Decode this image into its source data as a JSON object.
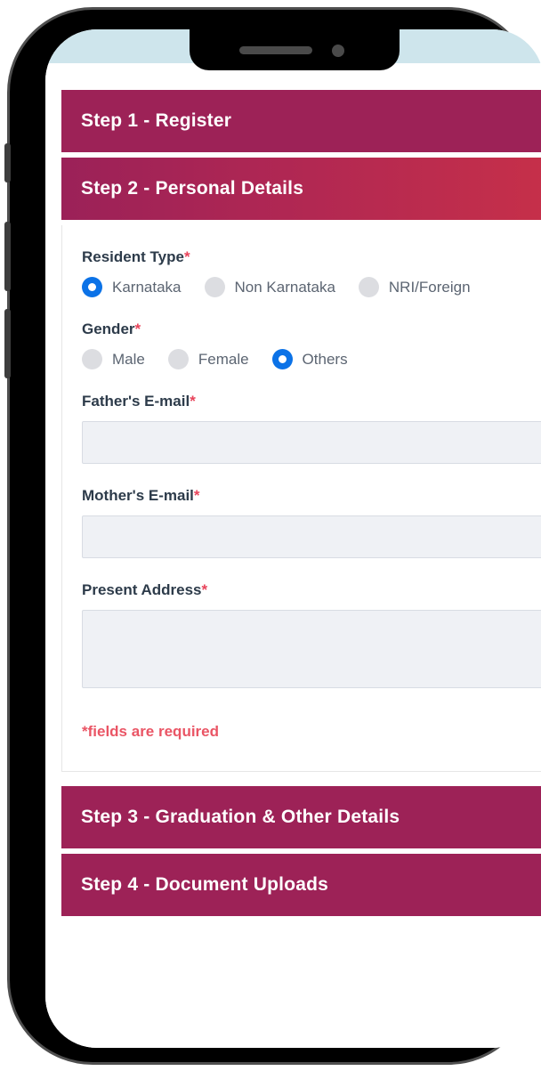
{
  "device": {
    "notch": {
      "speaker_icon": "speaker-grill-icon",
      "camera_icon": "front-camera-icon"
    },
    "buttons": {
      "mute": "mute-switch",
      "volume_up": "volume-up-button",
      "volume_down": "volume-down-button",
      "power": "power-button"
    }
  },
  "form": {
    "steps": [
      {
        "label": "Step 1 - Register",
        "state": "collapsed"
      },
      {
        "label": "Step 2 - Personal Details",
        "state": "expanded"
      },
      {
        "label": "Step 3 - Graduation & Other Details",
        "state": "collapsed"
      },
      {
        "label": "Step 4 - Document Uploads",
        "state": "collapsed"
      }
    ],
    "fields": {
      "resident_type": {
        "label": "Resident Type",
        "required_marker": "*",
        "options": [
          {
            "label": "Karnataka",
            "selected": true
          },
          {
            "label": "Non Karnataka",
            "selected": false
          },
          {
            "label": "NRI/Foreign",
            "selected": false
          }
        ]
      },
      "gender": {
        "label": "Gender",
        "required_marker": "*",
        "options": [
          {
            "label": "Male",
            "selected": false
          },
          {
            "label": "Female",
            "selected": false
          },
          {
            "label": "Others",
            "selected": true
          }
        ]
      },
      "father_email": {
        "label": "Father's E-mail",
        "required_marker": "*",
        "value": "",
        "placeholder": ""
      },
      "mother_email": {
        "label": "Mother's E-mail",
        "required_marker": "*",
        "value": "",
        "placeholder": ""
      },
      "present_address": {
        "label": "Present Address",
        "required_marker": "*",
        "value": "",
        "placeholder": ""
      }
    },
    "required_note": "*fields are required"
  },
  "colors": {
    "brand_maroon": "#9d2257",
    "brand_gradient_end": "#c73049",
    "radio_selected_blue": "#0b72e7",
    "radio_unselected_gray": "#dcdde1",
    "label_text": "#2d3b4a",
    "required_red": "#ea5565",
    "input_bg": "#eff1f5",
    "status_bar_tint": "#cee5ec"
  }
}
